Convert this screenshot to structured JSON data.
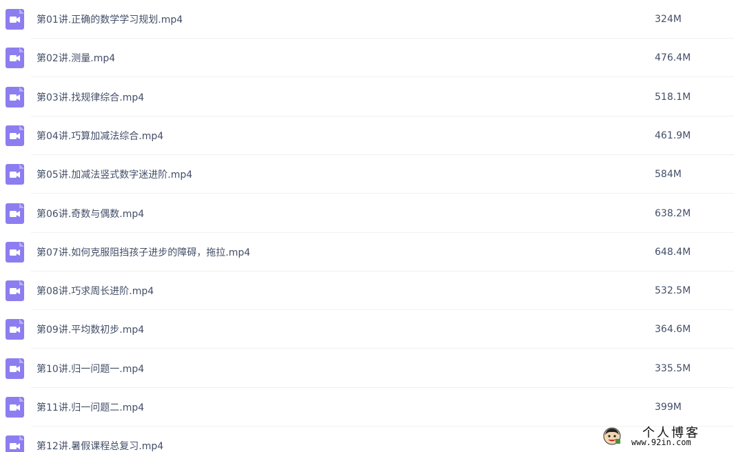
{
  "files": [
    {
      "name": "第01讲.正确的数学学习规划.mp4",
      "size": "324M",
      "icon": "video-file-icon"
    },
    {
      "name": "第02讲.测量.mp4",
      "size": "476.4M",
      "icon": "video-file-icon"
    },
    {
      "name": "第03讲.找规律综合.mp4",
      "size": "518.1M",
      "icon": "video-file-icon"
    },
    {
      "name": "第04讲.巧算加减法综合.mp4",
      "size": "461.9M",
      "icon": "video-file-icon"
    },
    {
      "name": "第05讲.加减法竖式数字迷进阶.mp4",
      "size": "584M",
      "icon": "video-file-icon"
    },
    {
      "name": "第06讲.奇数与偶数.mp4",
      "size": "638.2M",
      "icon": "video-file-icon"
    },
    {
      "name": "第07讲.如何克服阻挡孩子进步的障碍，拖拉.mp4",
      "size": "648.4M",
      "icon": "video-file-icon"
    },
    {
      "name": "第08讲.巧求周长进阶.mp4",
      "size": "532.5M",
      "icon": "video-file-icon"
    },
    {
      "name": "第09讲.平均数初步.mp4",
      "size": "364.6M",
      "icon": "video-file-icon"
    },
    {
      "name": "第10讲.归一问题一.mp4",
      "size": "335.5M",
      "icon": "video-file-icon"
    },
    {
      "name": "第11讲.归一问题二.mp4",
      "size": "399M",
      "icon": "video-file-icon"
    },
    {
      "name": "第12讲.暑假课程总复习.mp4",
      "size": "",
      "icon": "video-file-icon"
    }
  ],
  "watermark": {
    "title": "个人博客",
    "url": "www.92in.com"
  },
  "colors": {
    "icon_bg": "#8c7ef0",
    "text": "#424e67",
    "divider": "#f0f0f2"
  }
}
